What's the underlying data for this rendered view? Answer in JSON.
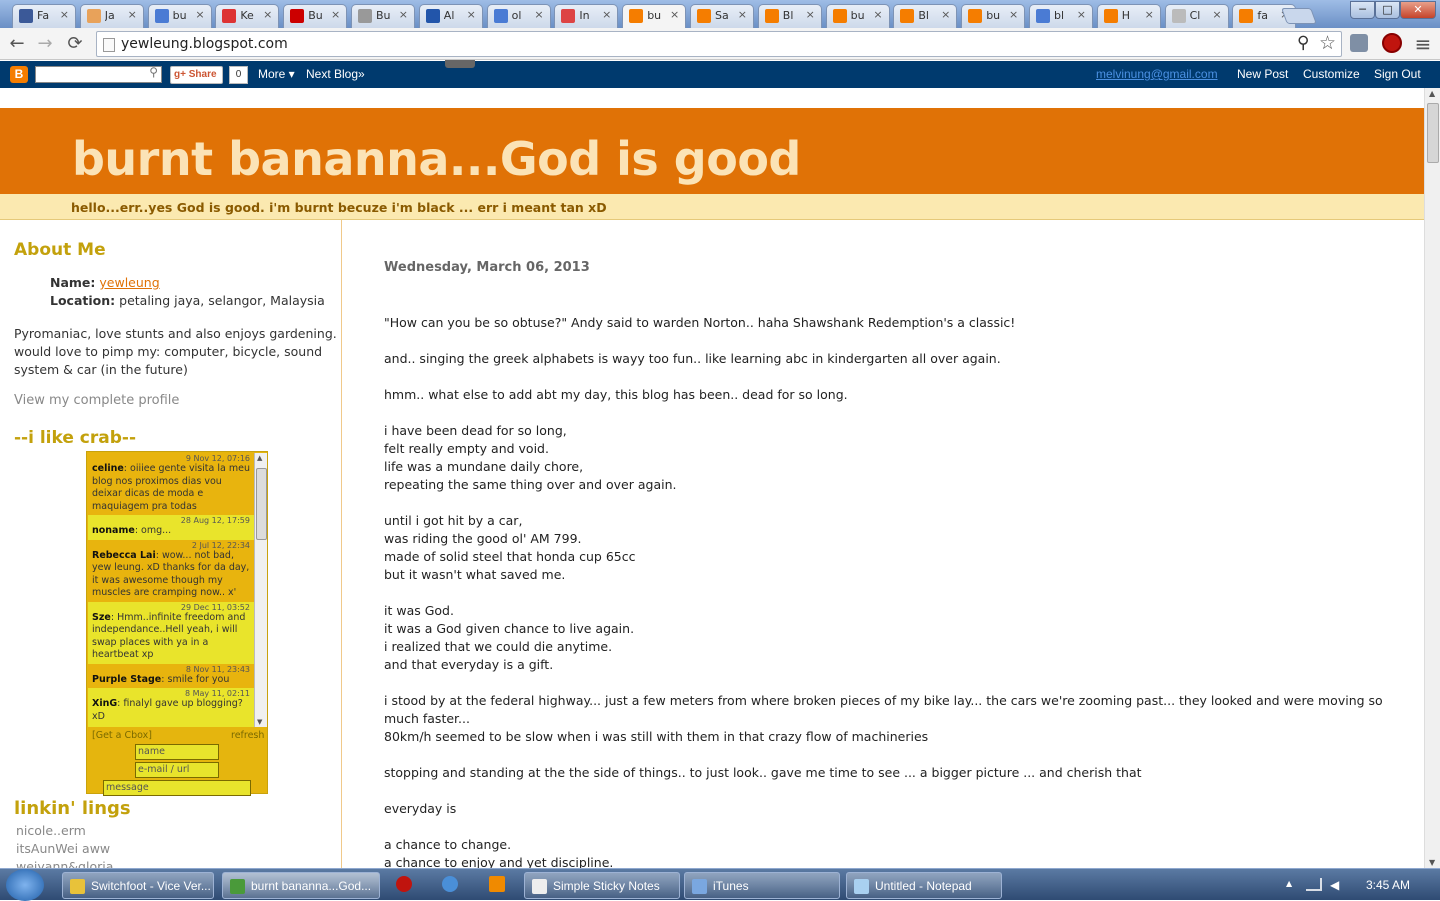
{
  "browser": {
    "tabs": [
      {
        "title": "Fa",
        "color": "#3b5998"
      },
      {
        "title": "Ja",
        "color": "#e8a25a"
      },
      {
        "title": "bu",
        "color": "#4a7bd4"
      },
      {
        "title": "Ke",
        "color": "#d33"
      },
      {
        "title": "Bu",
        "color": "#c00"
      },
      {
        "title": "Bu",
        "color": "#999"
      },
      {
        "title": "Al",
        "color": "#2255aa"
      },
      {
        "title": "ol",
        "color": "#4a7bd4"
      },
      {
        "title": "In",
        "color": "#d44"
      },
      {
        "title": "bu",
        "color": "#f57d00"
      },
      {
        "title": "Sa",
        "color": "#f57d00"
      },
      {
        "title": "Bl",
        "color": "#f57d00"
      },
      {
        "title": "bu",
        "color": "#f57d00"
      },
      {
        "title": "Bl",
        "color": "#f57d00"
      },
      {
        "title": "bu",
        "color": "#f57d00"
      },
      {
        "title": "bl",
        "color": "#4a7bd4"
      },
      {
        "title": "H",
        "color": "#f57d00"
      },
      {
        "title": "Cl",
        "color": "#bbb"
      },
      {
        "title": "fa",
        "color": "#f57d00"
      }
    ],
    "tab_close": "×",
    "url": "yewleung.blogspot.com",
    "back": "←",
    "forward": "→",
    "reload": "⟳",
    "star": "☆",
    "menu": "≡",
    "zoom": "⚲",
    "win_min": "─",
    "win_max": "□",
    "win_close": "✕"
  },
  "navbar": {
    "blogger_logo": "B",
    "share": "g+ Share",
    "share_count": "0",
    "more": "More ▾",
    "next_blog": "Next Blog»",
    "email": "melvinung@gmail.com",
    "new_post": "New Post",
    "customize": "Customize",
    "sign_out": "Sign Out"
  },
  "blog": {
    "title": "burnt bananna...God is good",
    "tagline": "hello...err..yes God is good. i'm burnt becuze i'm black ... err i meant tan xD"
  },
  "sidebar": {
    "about_heading": "About Me",
    "name_label": "Name:",
    "name_value": "yewleung",
    "location_label": "Location:",
    "location_value": "petaling jaya, selangor, Malaysia",
    "bio": "Pyromaniac, love stunts and also enjoys gardening. would love to pimp my: computer, bicycle, sound system & car (in the future)",
    "profile_link": "View my complete profile",
    "crab_heading": "--i like crab--",
    "links_heading": "linkin' lings",
    "links": [
      "nicole..erm",
      "itsAunWei aww",
      "weiyann&gloria"
    ]
  },
  "cbox": {
    "messages": [
      {
        "date": "9 Nov 12, 07:16",
        "name": "celine",
        "text": "oiiiee gente visita la meu blog nos proximos dias vou deixar dicas de moda e maquiagem pra todas"
      },
      {
        "date": "28 Aug 12, 17:59",
        "name": "noname",
        "text": "omg..."
      },
      {
        "date": "2 Jul 12, 22:34",
        "name": "Rebecca Lai",
        "text": "wow... not bad, yew leung. xD thanks for da day, it was awesome though my muscles are cramping now.. x'"
      },
      {
        "date": "29 Dec 11, 03:52",
        "name": "Sze",
        "text": "Hmm..infinite freedom and independance..Hell yeah, i will swap places with ya in a heartbeat xp"
      },
      {
        "date": "8 Nov 11, 23:43",
        "name": "Purple Stage",
        "text": "smile for you"
      },
      {
        "date": "8 May 11, 02:11",
        "name": "XinG",
        "text": "finalyl gave up blogging? xD"
      }
    ],
    "get_link": "[Get a Cbox]",
    "refresh": "refresh",
    "name_placeholder": "name",
    "url_placeholder": "e-mail / url",
    "message_placeholder": "message"
  },
  "post": {
    "date": "Wednesday, March 06, 2013",
    "paragraphs": [
      "\"How can you be so obtuse?\" Andy said to warden Norton.. haha Shawshank Redemption's a classic!",
      "and.. singing the greek alphabets is wayy too fun.. like learning abc in kindergarten all over again.",
      "hmm.. what else to add abt my day, this blog has been.. dead for so long.",
      "i have been dead for so long,\nfelt really empty and void.\nlife was a mundane daily chore,\nrepeating the same thing over and over again.",
      "until i got hit by a car,\nwas riding the good ol' AM 799.\nmade of solid steel that honda cup 65cc\nbut it wasn't what saved me.",
      "it was God.\nit was a God given chance to live again.\ni realized that we could die anytime.\nand that everyday is a gift.",
      "i stood by at the federal highway... just a few meters from where broken pieces of my bike lay... the cars we're zooming past... they looked and were moving so much faster...\n80km/h seemed to be slow when i was still with them in that crazy flow of machineries",
      "stopping and standing at the the side of things.. to just look.. gave me time to see ... a bigger picture ... and cherish that",
      "everyday is",
      "a chance to change.\na chance to enjoy and yet discipline."
    ]
  },
  "taskbar": {
    "tasks": [
      {
        "label": "Switchfoot - Vice Ver...",
        "color": "#e8c23a"
      },
      {
        "label": "burnt bananna...God...",
        "color": "#4a9a3a"
      },
      {
        "label": "Simple Sticky Notes",
        "color": "#eee"
      },
      {
        "label": "iTunes",
        "color": "#7aa7e0"
      },
      {
        "label": "Untitled - Notepad",
        "color": "#a9d0f0"
      }
    ],
    "tray_up": "▲",
    "time": "3:45 AM"
  }
}
